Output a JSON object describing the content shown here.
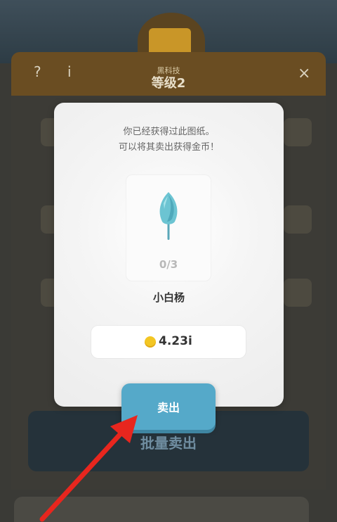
{
  "background": {
    "help_icon_text": "?",
    "info_icon_text": "i",
    "close_icon_text": "×",
    "level_subtitle": "黑科技",
    "level_label": "等级2",
    "bulk_sell_label": "批量卖出"
  },
  "dialog": {
    "message_line1": "你已经获得过此图纸。",
    "message_line2": "可以将其卖出获得金币！",
    "item": {
      "icon": "poplar-tree-leaf-icon",
      "progress": "0/3",
      "name": "小白杨"
    },
    "price": {
      "coin_icon": "gold-coin-icon",
      "value": "4.23i"
    },
    "sell_button_label": "卖出"
  },
  "colors": {
    "sell_button": "#55a9c9",
    "coin": "#f3c623",
    "arrow": "#e8261e"
  }
}
